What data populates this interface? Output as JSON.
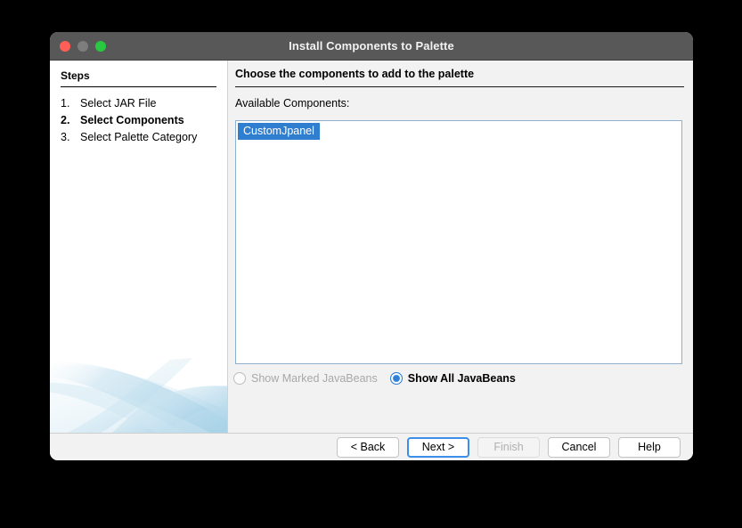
{
  "window": {
    "title": "Install Components to Palette",
    "traffic_lights": [
      {
        "name": "close-button",
        "color": "#ff5f57"
      },
      {
        "name": "minimize-button",
        "color": "#7d7d7d"
      },
      {
        "name": "maximize-button",
        "color": "#28c840"
      }
    ]
  },
  "steps_panel": {
    "heading": "Steps",
    "items": [
      {
        "number": "1.",
        "label": "Select JAR File",
        "current": false
      },
      {
        "number": "2.",
        "label": "Select Components",
        "current": true
      },
      {
        "number": "3.",
        "label": "Select Palette Category",
        "current": false
      }
    ]
  },
  "main": {
    "title": "Choose the components to add to the palette",
    "available_label": "Available Components:",
    "components": [
      {
        "label": "CustomJpanel",
        "selected": true
      }
    ],
    "radio_group": {
      "options": [
        {
          "label": "Show Marked JavaBeans",
          "selected": false,
          "disabled": true
        },
        {
          "label": "Show All JavaBeans",
          "selected": true,
          "disabled": false
        }
      ]
    }
  },
  "footer": {
    "buttons": [
      {
        "label": "< Back",
        "state": "normal"
      },
      {
        "label": "Next >",
        "state": "focused"
      },
      {
        "label": "Finish",
        "state": "disabled"
      },
      {
        "label": "Cancel",
        "state": "normal"
      },
      {
        "label": "Help",
        "state": "normal"
      }
    ]
  },
  "colors": {
    "titlebar": "#585858",
    "selection_blue": "#2f7ed0",
    "focus_blue": "#3b8eea",
    "panel_gray": "#f2f2f2",
    "watermark_blue": "#bcdced"
  }
}
